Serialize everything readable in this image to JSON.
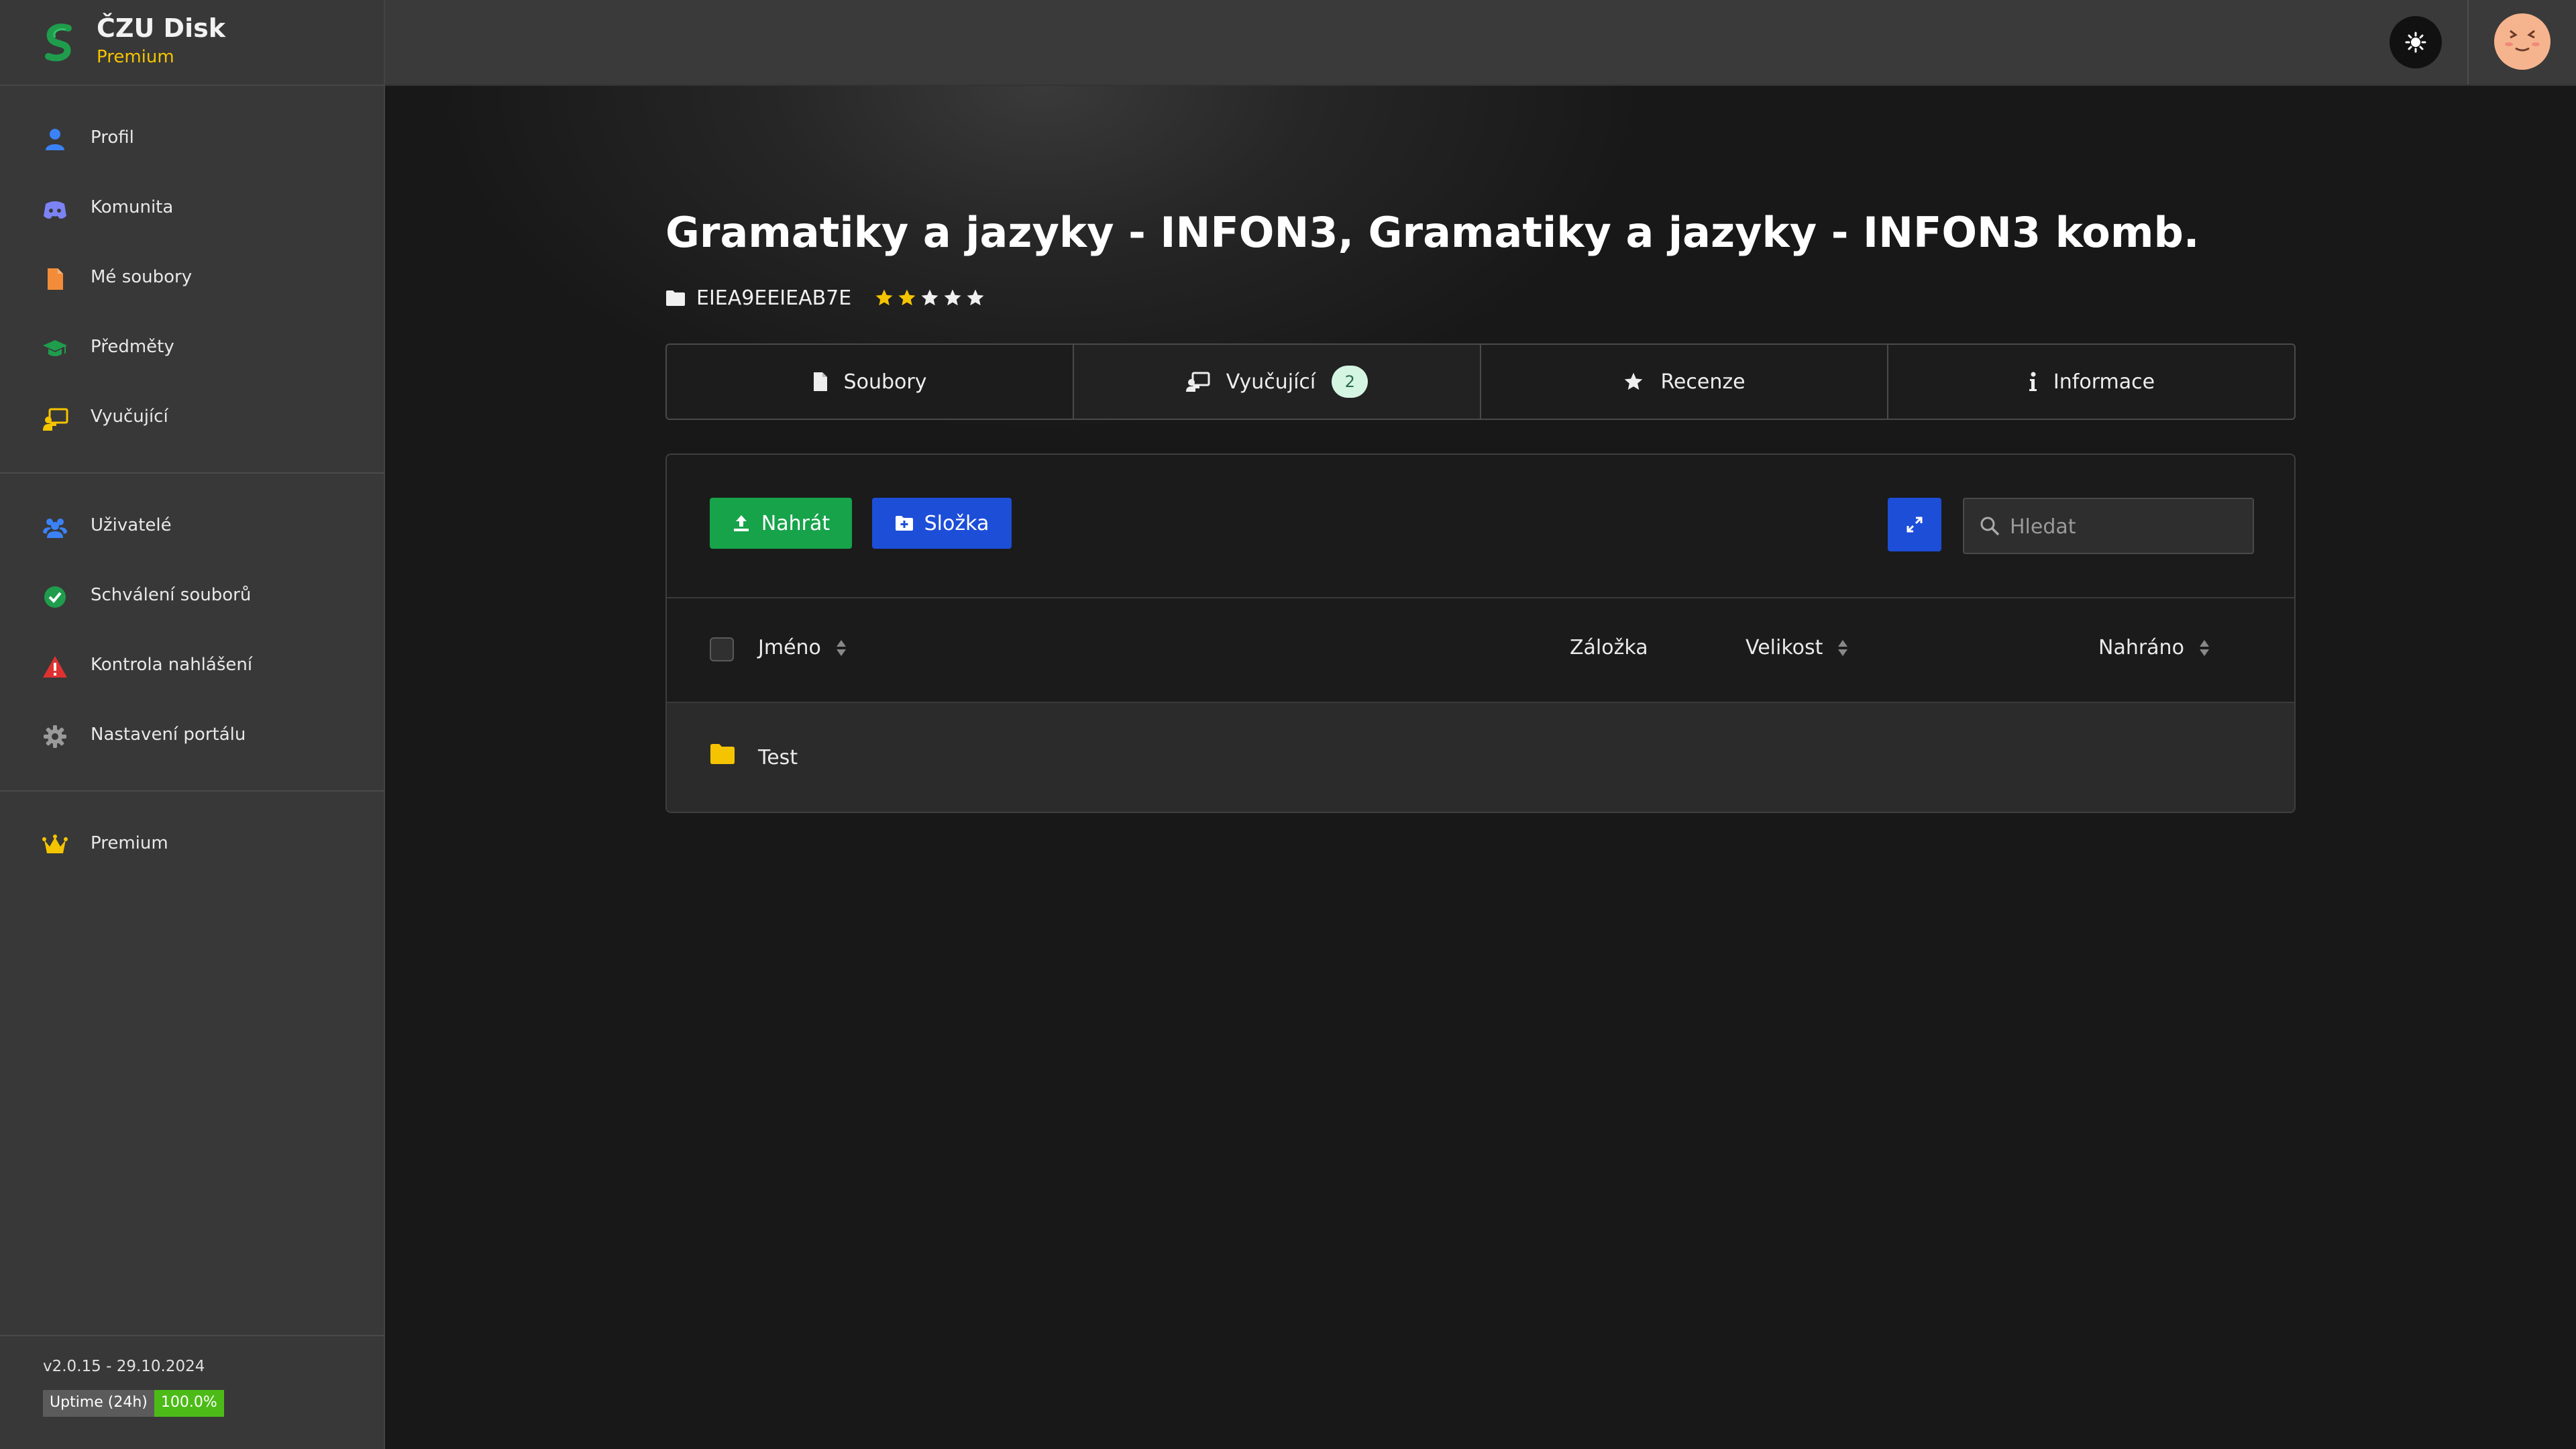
{
  "app": {
    "title": "ČZU Disk",
    "subtitle": "Premium"
  },
  "sidebar": {
    "group1": [
      {
        "label": "Profil",
        "icon": "user-icon"
      },
      {
        "label": "Komunita",
        "icon": "discord-icon"
      },
      {
        "label": "Mé soubory",
        "icon": "file-icon"
      },
      {
        "label": "Předměty",
        "icon": "graduation-cap-icon"
      },
      {
        "label": "Vyučující",
        "icon": "teacher-icon"
      }
    ],
    "group2": [
      {
        "label": "Uživatelé",
        "icon": "users-icon"
      },
      {
        "label": "Schválení souborů",
        "icon": "check-circle-icon"
      },
      {
        "label": "Kontrola nahlášení",
        "icon": "warning-icon"
      },
      {
        "label": "Nastavení portálu",
        "icon": "gear-icon"
      }
    ],
    "group3": [
      {
        "label": "Premium",
        "icon": "crown-icon"
      }
    ],
    "version": "v2.0.15 - 29.10.2024",
    "uptime_label": "Uptime (24h)",
    "uptime_value": "100.0%"
  },
  "page": {
    "title": "Gramatiky a jazyky - INFON3, Gramatiky a jazyky - INFON3 komb.",
    "code": "EIEA9EEIEAB7E",
    "rating": 2,
    "rating_max": 5
  },
  "tabs": [
    {
      "label": "Soubory",
      "icon": "file-icon"
    },
    {
      "label": "Vyučující",
      "icon": "teacher-icon",
      "badge": "2"
    },
    {
      "label": "Recenze",
      "icon": "star-icon"
    },
    {
      "label": "Informace",
      "icon": "info-icon"
    }
  ],
  "toolbar": {
    "upload_label": "Nahrát",
    "folder_label": "Složka",
    "search_placeholder": "Hledat"
  },
  "table": {
    "columns": {
      "name": "Jméno",
      "bookmark": "Záložka",
      "size": "Velikost",
      "uploaded": "Nahráno"
    },
    "rows": [
      {
        "name": "Test",
        "type": "folder"
      }
    ]
  },
  "colors": {
    "accent_green": "#17a34a",
    "accent_blue": "#1d4ed8",
    "premium_yellow": "#f5c400",
    "star_yellow": "#f5c400",
    "uptime_green": "#4cbb17"
  }
}
